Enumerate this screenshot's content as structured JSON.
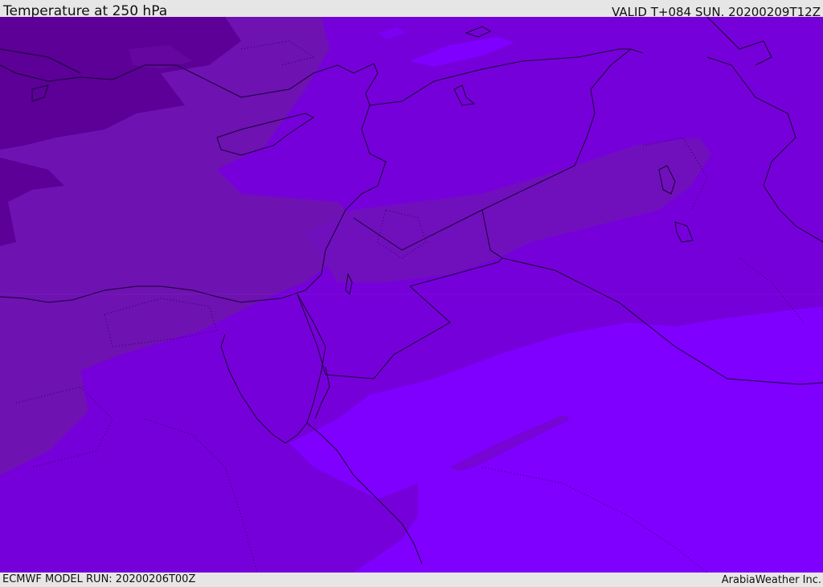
{
  "header": {
    "title": "Temperature at 250 hPa",
    "valid_time": "VALID T+084 SUN. 20200209T12Z"
  },
  "footer": {
    "model_run": "ECMWF MODEL RUN: 20200206T00Z",
    "credit": "ArabiaWeather Inc."
  },
  "colors": {
    "coldest": "#5c0098",
    "cold": "#6e12b2",
    "mid": "#7400d0",
    "warm": "#7a00e6",
    "warmest": "#7f00ff",
    "coastline": "#1a0033"
  }
}
